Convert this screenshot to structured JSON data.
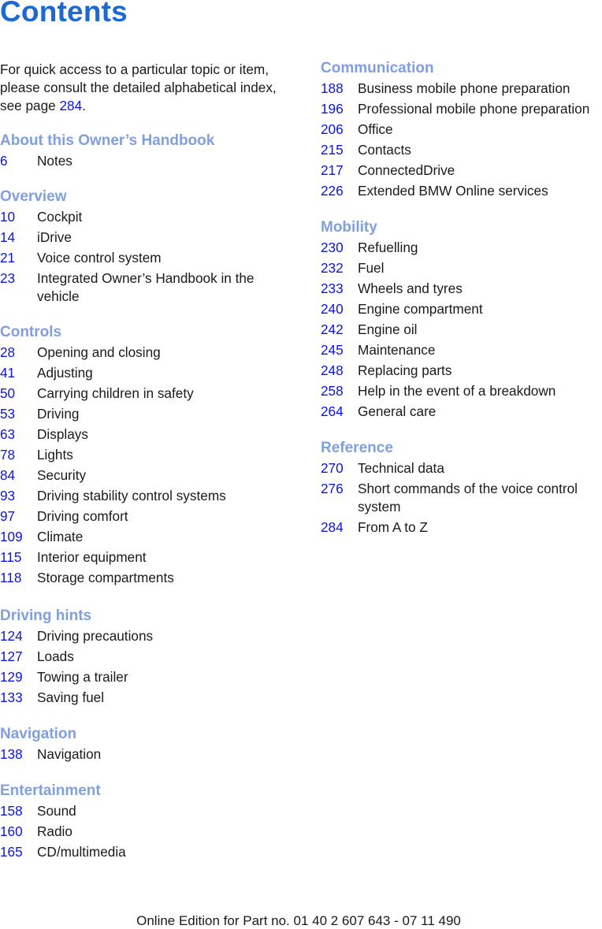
{
  "page": {
    "title": "Contents",
    "intro": {
      "text_before": "For quick access to a particular topic or item, please consult the detailed alphabetical index, see page ",
      "page_link": "284",
      "text_after": "."
    },
    "footer": "Online Edition for Part no. 01 40 2 607 643 - 07 11 490"
  },
  "colors": {
    "title": "#1c69d4",
    "section_heading": "#7f9fde",
    "page_number": "#0a14e6",
    "body_text": "#1a1a1a"
  },
  "left_column": [
    {
      "heading": "About this Owner’s Handbook",
      "entries": [
        {
          "page": "6",
          "label": "Notes"
        }
      ]
    },
    {
      "heading": "Overview",
      "entries": [
        {
          "page": "10",
          "label": "Cockpit"
        },
        {
          "page": "14",
          "label": "iDrive"
        },
        {
          "page": "21",
          "label": "Voice control system"
        },
        {
          "page": "23",
          "label": "Integrated Owner’s Handbook in the vehicle"
        }
      ]
    },
    {
      "heading": "Controls",
      "entries": [
        {
          "page": "28",
          "label": "Opening and closing"
        },
        {
          "page": "41",
          "label": "Adjusting"
        },
        {
          "page": "50",
          "label": "Carrying children in safety"
        },
        {
          "page": "53",
          "label": "Driving"
        },
        {
          "page": "63",
          "label": "Displays"
        },
        {
          "page": "78",
          "label": "Lights"
        },
        {
          "page": "84",
          "label": "Security"
        },
        {
          "page": "93",
          "label": "Driving stability control systems"
        },
        {
          "page": "97",
          "label": "Driving comfort"
        },
        {
          "page": "109",
          "label": "Climate"
        },
        {
          "page": "115",
          "label": "Interior equipment"
        },
        {
          "page": "118",
          "label": "Storage compartments"
        }
      ]
    },
    {
      "heading": "Driving hints",
      "entries": [
        {
          "page": "124",
          "label": "Driving precautions"
        },
        {
          "page": "127",
          "label": "Loads"
        },
        {
          "page": "129",
          "label": "Towing a trailer"
        },
        {
          "page": "133",
          "label": "Saving fuel"
        }
      ]
    },
    {
      "heading": "Navigation",
      "entries": [
        {
          "page": "138",
          "label": "Navigation"
        }
      ]
    },
    {
      "heading": "Entertainment",
      "entries": [
        {
          "page": "158",
          "label": "Sound"
        },
        {
          "page": "160",
          "label": "Radio"
        },
        {
          "page": "165",
          "label": "CD/multimedia"
        }
      ]
    }
  ],
  "right_column": [
    {
      "heading": "Communication",
      "entries": [
        {
          "page": "188",
          "label": "Business mobile phone preparation"
        },
        {
          "page": "196",
          "label": "Professional mobile phone preparation"
        },
        {
          "page": "206",
          "label": "Office"
        },
        {
          "page": "215",
          "label": "Contacts"
        },
        {
          "page": "217",
          "label": "ConnectedDrive"
        },
        {
          "page": "226",
          "label": "Extended BMW Online services"
        }
      ]
    },
    {
      "heading": "Mobility",
      "entries": [
        {
          "page": "230",
          "label": "Refuelling"
        },
        {
          "page": "232",
          "label": "Fuel"
        },
        {
          "page": "233",
          "label": "Wheels and tyres"
        },
        {
          "page": "240",
          "label": "Engine compartment"
        },
        {
          "page": "242",
          "label": "Engine oil"
        },
        {
          "page": "245",
          "label": "Maintenance"
        },
        {
          "page": "248",
          "label": "Replacing parts"
        },
        {
          "page": "258",
          "label": "Help in the event of a breakdown"
        },
        {
          "page": "264",
          "label": "General care"
        }
      ]
    },
    {
      "heading": "Reference",
      "entries": [
        {
          "page": "270",
          "label": "Technical data"
        },
        {
          "page": "276",
          "label": "Short commands of the voice control system"
        },
        {
          "page": "284",
          "label": "From A to Z"
        }
      ]
    }
  ]
}
